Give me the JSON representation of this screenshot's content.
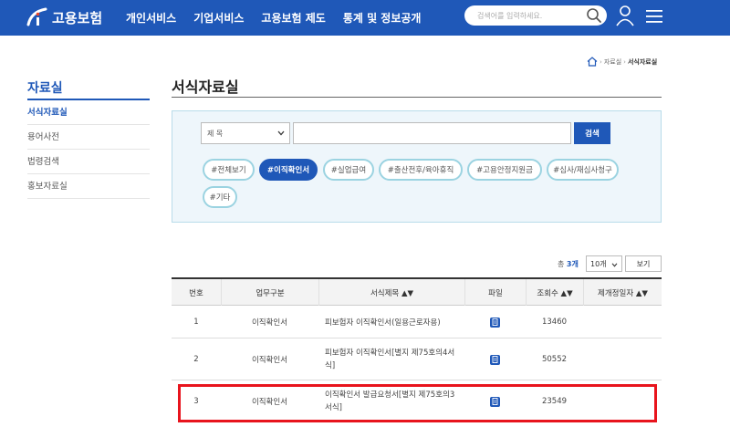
{
  "header": {
    "logo_text": "고용보험",
    "nav": [
      "개인서비스",
      "기업서비스",
      "고용보험 제도",
      "통계 및 정보공개"
    ],
    "search_placeholder": "검색어를 입력하세요.",
    "brand_color": "#1f58b8"
  },
  "breadcrumb": {
    "items": [
      "자료실",
      "서식자료실"
    ]
  },
  "sidebar": {
    "title": "자료실",
    "items": [
      {
        "label": "서식자료실",
        "active": true
      },
      {
        "label": "용어사전",
        "active": false
      },
      {
        "label": "법령검색",
        "active": false
      },
      {
        "label": "홍보자료실",
        "active": false
      }
    ]
  },
  "main": {
    "title": "서식자료실",
    "filter": {
      "select_value": "제 목",
      "keyword_value": "",
      "search_label": "검색",
      "tags": [
        {
          "label": "#전체보기",
          "active": false
        },
        {
          "label": "#이직확인서",
          "active": true
        },
        {
          "label": "#실업급여",
          "active": false
        },
        {
          "label": "#출산전후/육아휴직",
          "active": false
        },
        {
          "label": "#고용안정지원금",
          "active": false
        },
        {
          "label": "#심사/재심사청구",
          "active": false
        },
        {
          "label": "#기타",
          "active": false
        }
      ]
    },
    "count_prefix": "총",
    "count_value": "3개",
    "page_size": "10개",
    "view_label": "보기",
    "table": {
      "headers": [
        "번호",
        "업무구분",
        "서식제목 ▲▼",
        "파일",
        "조회수 ▲▼",
        "제개정일자 ▲▼"
      ],
      "rows": [
        {
          "no": "1",
          "category": "이직확인서",
          "title": "피보험자 이직확인서(일용근로자용)",
          "views": "13460",
          "date": ""
        },
        {
          "no": "2",
          "category": "이직확인서",
          "title": "피보험자 이직확인서[별지 제75호의4서식]",
          "views": "50552",
          "date": ""
        },
        {
          "no": "3",
          "category": "이직확인서",
          "title": "이직확인서 발급요청서[별지 제75호의3서식]",
          "views": "23549",
          "date": ""
        }
      ]
    }
  },
  "icons": {
    "search": "search-icon",
    "user": "user-icon",
    "menu": "menu-icon",
    "home": "home-icon",
    "file": "file-icon"
  },
  "highlight_color": "#e8141d"
}
